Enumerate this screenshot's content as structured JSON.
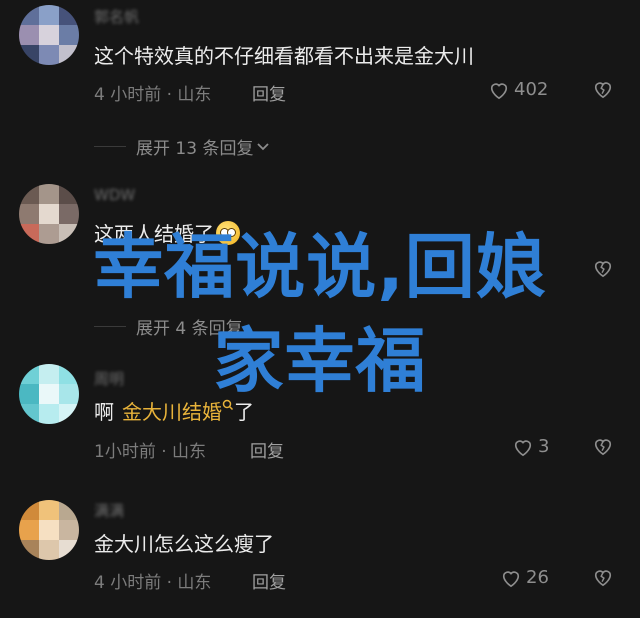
{
  "comments": [
    {
      "username": "郭名帆",
      "text": "这个特效真的不仔细看都看不出来是金大川",
      "meta": "4 小时前 · 山东",
      "reply": "回复",
      "likes": "402"
    },
    {
      "expand": "展开 13 条回复"
    },
    {
      "username": "WDW",
      "text": "这两人结婚了",
      "meta": "4 小时前 · 山东",
      "reply": "回复",
      "likes": ""
    },
    {
      "expand": "展开 4 条回复"
    },
    {
      "username": "周明",
      "text_before": "啊",
      "link": "金大川结婚",
      "text_after": "了",
      "meta": "1小时前 · 山东",
      "reply": "回复",
      "likes": "3"
    },
    {
      "username": "满满",
      "text": "金大川怎么这么瘦了",
      "meta": "4 小时前 · 山东",
      "reply": "回复",
      "likes": "26"
    }
  ],
  "overlay": {
    "line1": "幸福说说,回娘",
    "line2": "家幸福",
    "color": "#2f7fd6"
  },
  "icons": {
    "like": "heart-outline-icon",
    "dislike": "broken-heart-icon",
    "expand": "chevron-down-icon",
    "search_link": "search-icon"
  }
}
